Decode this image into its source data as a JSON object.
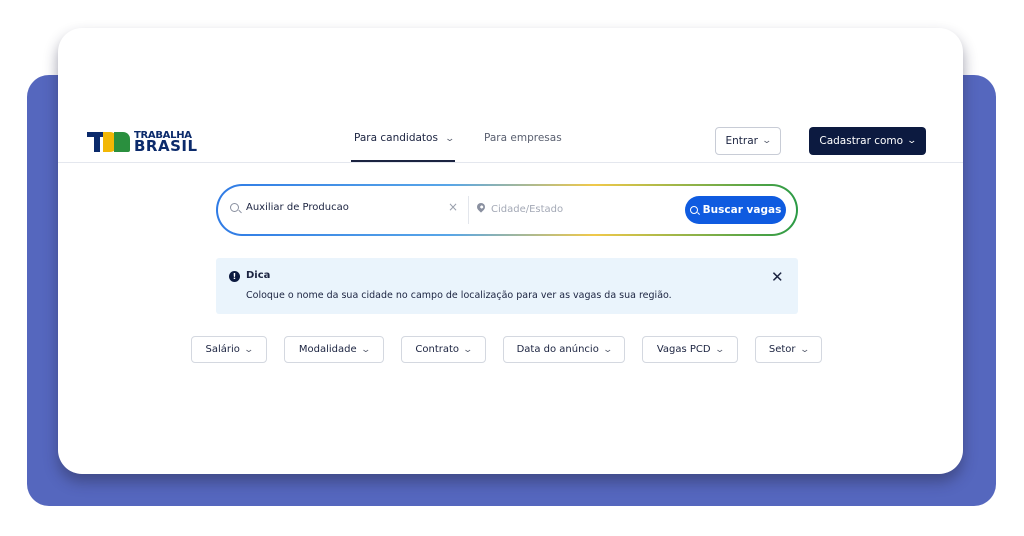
{
  "brand": {
    "logo_line1": "TRABALHA",
    "logo_line2": "BRASIL"
  },
  "nav": {
    "candidates_label": "Para candidatos",
    "companies_label": "Para empresas",
    "login_label": "Entrar",
    "signup_label": "Cadastrar como"
  },
  "search": {
    "query_value": "Auxiliar de Producao",
    "location_placeholder": "Cidade/Estado",
    "button_label": "Buscar vagas"
  },
  "tip": {
    "title": "Dica",
    "message": "Coloque o nome da sua cidade no campo de localização para ver as vagas da sua região."
  },
  "filters": [
    {
      "label": "Salário"
    },
    {
      "label": "Modalidade"
    },
    {
      "label": "Contrato"
    },
    {
      "label": "Data do anúncio"
    },
    {
      "label": "Vagas PCD"
    },
    {
      "label": "Setor"
    }
  ],
  "colors": {
    "backdrop": "#5567be",
    "primary_dark": "#0c1a40",
    "accent_blue": "#0f5be0",
    "tip_bg": "#eaf4fc"
  }
}
